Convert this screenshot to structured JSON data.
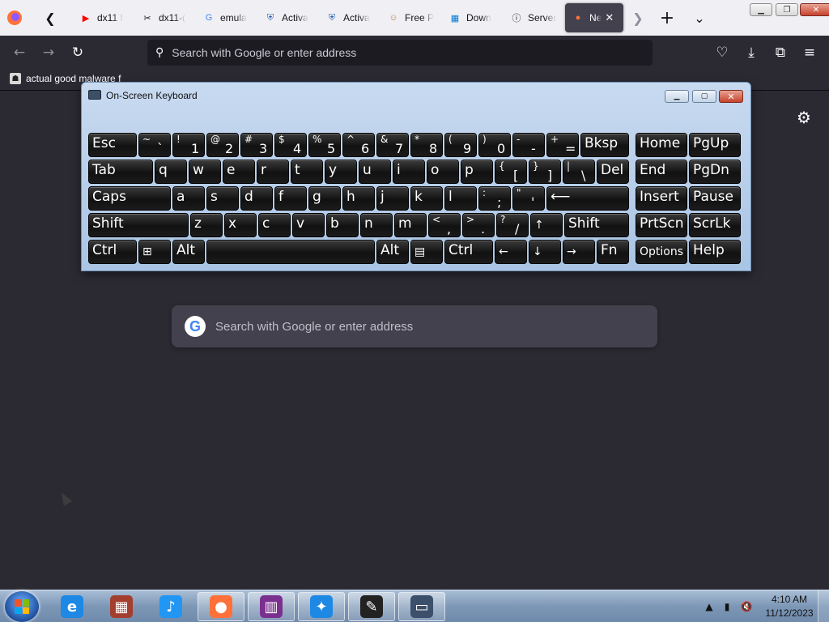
{
  "browser": {
    "tabs": [
      {
        "title": "dx11 f",
        "icon": "youtube-icon",
        "color": "#ff0000"
      },
      {
        "title": "dx11-(",
        "icon": "tools-icon",
        "color": "#15141a"
      },
      {
        "title": "emula",
        "icon": "google-icon",
        "color": "#4285f4"
      },
      {
        "title": "Activa",
        "icon": "shield-icon",
        "color": "#2a5db0"
      },
      {
        "title": "Activa",
        "icon": "shield-icon",
        "color": "#2a5db0"
      },
      {
        "title": "Free P",
        "icon": "avatar-icon",
        "color": "#c08050"
      },
      {
        "title": "Down",
        "icon": "windows-logo-icon",
        "color": "#0078d7"
      },
      {
        "title": "Server",
        "icon": "info-icon",
        "color": "#15141a"
      },
      {
        "title": "Ne",
        "icon": "firefox-icon",
        "color": "#ff7139",
        "active": true
      }
    ],
    "address_placeholder": "Search with Google or enter address",
    "bookmark": "actual good malware f",
    "newtab_search_placeholder": "Search with Google or enter address"
  },
  "osk": {
    "title": "On-Screen Keyboard",
    "rows": [
      [
        {
          "label": "Esc",
          "w": 60
        },
        {
          "top": "~",
          "bot": "`",
          "w": 40
        },
        {
          "top": "!",
          "bot": "1",
          "w": 40
        },
        {
          "top": "@",
          "bot": "2",
          "w": 40
        },
        {
          "top": "#",
          "bot": "3",
          "w": 40
        },
        {
          "top": "$",
          "bot": "4",
          "w": 40
        },
        {
          "top": "%",
          "bot": "5",
          "w": 40
        },
        {
          "top": "^",
          "bot": "6",
          "w": 40
        },
        {
          "top": "&",
          "bot": "7",
          "w": 40
        },
        {
          "top": "*",
          "bot": "8",
          "w": 40
        },
        {
          "top": "(",
          "bot": "9",
          "w": 40
        },
        {
          "top": ")",
          "bot": "0",
          "w": 40
        },
        {
          "top": "-",
          "bot": "-",
          "w": 40
        },
        {
          "top": "+",
          "bot": "=",
          "w": 40
        },
        {
          "label": "Bksp",
          "w": 60
        },
        {
          "gap": 6
        },
        {
          "label": "Home",
          "w": 64
        },
        {
          "label": "PgUp",
          "w": 64
        }
      ],
      [
        {
          "label": "Tab",
          "w": 80
        },
        {
          "label": "q",
          "w": 40
        },
        {
          "label": "w",
          "w": 40
        },
        {
          "label": "e",
          "w": 40
        },
        {
          "label": "r",
          "w": 40
        },
        {
          "label": "t",
          "w": 40
        },
        {
          "label": "y",
          "w": 40
        },
        {
          "label": "u",
          "w": 40
        },
        {
          "label": "i",
          "w": 40
        },
        {
          "label": "o",
          "w": 40
        },
        {
          "label": "p",
          "w": 40
        },
        {
          "top": "{",
          "bot": "[",
          "w": 40
        },
        {
          "top": "}",
          "bot": "]",
          "w": 40
        },
        {
          "top": "|",
          "bot": "\\",
          "w": 40
        },
        {
          "label": "Del",
          "w": 40
        },
        {
          "gap": 6
        },
        {
          "label": "End",
          "w": 64
        },
        {
          "label": "PgDn",
          "w": 64
        }
      ],
      [
        {
          "label": "Caps",
          "w": 102
        },
        {
          "label": "a",
          "w": 40
        },
        {
          "label": "s",
          "w": 40
        },
        {
          "label": "d",
          "w": 40
        },
        {
          "label": "f",
          "w": 40
        },
        {
          "label": "g",
          "w": 40
        },
        {
          "label": "h",
          "w": 40
        },
        {
          "label": "j",
          "w": 40
        },
        {
          "label": "k",
          "w": 40
        },
        {
          "label": "l",
          "w": 40
        },
        {
          "top": ":",
          "bot": ";",
          "w": 40
        },
        {
          "top": "\"",
          "bot": "'",
          "w": 40
        },
        {
          "label": "⟵",
          "w": 102
        },
        {
          "gap": 6
        },
        {
          "label": "Insert",
          "w": 64
        },
        {
          "label": "Pause",
          "w": 64
        }
      ],
      [
        {
          "label": "Shift",
          "w": 124
        },
        {
          "label": "z",
          "w": 40
        },
        {
          "label": "x",
          "w": 40
        },
        {
          "label": "c",
          "w": 40
        },
        {
          "label": "v",
          "w": 40
        },
        {
          "label": "b",
          "w": 40
        },
        {
          "label": "n",
          "w": 40
        },
        {
          "label": "m",
          "w": 40
        },
        {
          "top": "<",
          "bot": ",",
          "w": 40
        },
        {
          "top": ">",
          "bot": ".",
          "w": 40
        },
        {
          "top": "?",
          "bot": "/",
          "w": 40
        },
        {
          "label": "↑",
          "w": 40,
          "small": true
        },
        {
          "label": "Shift",
          "w": 80
        },
        {
          "gap": 6
        },
        {
          "label": "PrtScn",
          "w": 64
        },
        {
          "label": "ScrLk",
          "w": 64
        }
      ],
      [
        {
          "label": "Ctrl",
          "w": 60
        },
        {
          "label": "⊞",
          "w": 40,
          "small": true
        },
        {
          "label": "Alt",
          "w": 40
        },
        {
          "label": "",
          "w": 208
        },
        {
          "label": "Alt",
          "w": 40
        },
        {
          "label": "▤",
          "w": 40,
          "small": true
        },
        {
          "label": "Ctrl",
          "w": 60
        },
        {
          "label": "←",
          "w": 40,
          "small": true
        },
        {
          "label": "↓",
          "w": 40,
          "small": true
        },
        {
          "label": "→",
          "w": 40,
          "small": true
        },
        {
          "label": "Fn",
          "w": 40
        },
        {
          "gap": 6
        },
        {
          "label": "Options",
          "w": 64,
          "small": true
        },
        {
          "label": "Help",
          "w": 64
        }
      ]
    ]
  },
  "taskbar": {
    "apps": [
      {
        "name": "internet-explorer",
        "glyph": "e",
        "color": "#1e88e5",
        "running": false
      },
      {
        "name": "media-library",
        "glyph": "▦",
        "color": "#a33f2f",
        "running": false
      },
      {
        "name": "itunes",
        "glyph": "♪",
        "color": "#2196f3",
        "running": false
      },
      {
        "name": "firefox",
        "glyph": "●",
        "color": "#ff7139",
        "running": true
      },
      {
        "name": "winrar",
        "glyph": "▥",
        "color": "#7b2f8f",
        "running": true
      },
      {
        "name": "tool-app",
        "glyph": "✦",
        "color": "#1e88e5",
        "running": true
      },
      {
        "name": "paint-app",
        "glyph": "✎",
        "color": "#222222",
        "running": true
      },
      {
        "name": "laptop-app",
        "glyph": "▭",
        "color": "#3c4f6b",
        "running": true
      }
    ],
    "time": "4:10 AM",
    "date": "11/12/2023"
  }
}
